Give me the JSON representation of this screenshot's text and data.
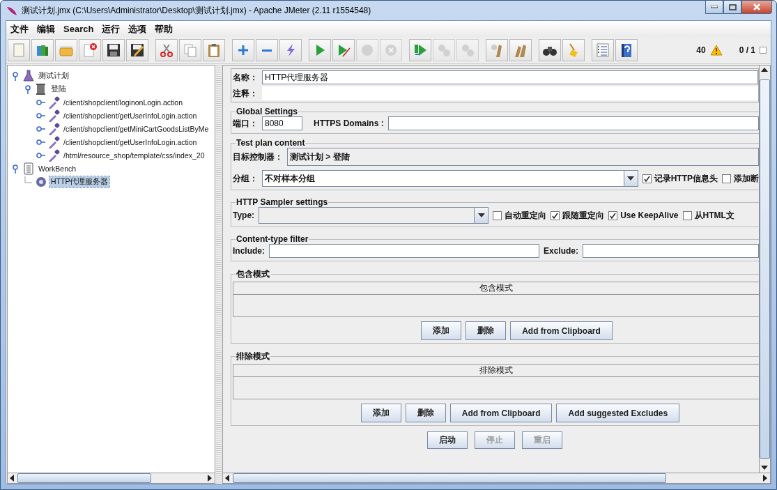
{
  "window": {
    "title": "测试计划.jmx (C:\\Users\\Administrator\\Desktop\\测试计划.jmx) - Apache JMeter (2.11 r1554548)"
  },
  "menu": [
    "文件",
    "编辑",
    "Search",
    "运行",
    "选项",
    "帮助"
  ],
  "toolbar": {
    "groups": [
      [
        {
          "kind": "new",
          "disabled": false
        },
        {
          "kind": "templates",
          "disabled": false
        },
        {
          "kind": "open",
          "disabled": false
        },
        {
          "kind": "close",
          "disabled": false
        },
        {
          "kind": "save",
          "disabled": false
        },
        {
          "kind": "saveas",
          "disabled": false
        }
      ],
      [
        {
          "kind": "cut",
          "disabled": false
        },
        {
          "kind": "copy",
          "disabled": false
        },
        {
          "kind": "paste",
          "disabled": false
        }
      ],
      [
        {
          "kind": "expand",
          "disabled": false
        },
        {
          "kind": "collapse",
          "disabled": false
        },
        {
          "kind": "toggle",
          "disabled": false
        }
      ],
      [
        {
          "kind": "start",
          "disabled": false
        },
        {
          "kind": "startnp",
          "disabled": false
        },
        {
          "kind": "stop",
          "disabled": true
        },
        {
          "kind": "shutdown",
          "disabled": true
        }
      ],
      [
        {
          "kind": "remotestart",
          "disabled": false
        },
        {
          "kind": "remotestop",
          "disabled": true
        },
        {
          "kind": "remoteshutdown",
          "disabled": true
        }
      ],
      [
        {
          "kind": "clear",
          "disabled": false
        },
        {
          "kind": "clearall",
          "disabled": false
        }
      ],
      [
        {
          "kind": "search",
          "disabled": false
        },
        {
          "kind": "reset",
          "disabled": false
        }
      ],
      [
        {
          "kind": "function",
          "disabled": false
        },
        {
          "kind": "help",
          "disabled": false
        }
      ]
    ],
    "error_count": "40",
    "threads": "0 / 1"
  },
  "tree": [
    {
      "label": "测试计划",
      "kind": "plan",
      "expanded": true,
      "selected": false,
      "children": [
        {
          "label": "登陆",
          "kind": "controller",
          "expanded": true,
          "selected": false,
          "children": [
            {
              "label": "/client/shopclient/loginonLogin.action",
              "kind": "sampler",
              "expanded": false,
              "selected": false
            },
            {
              "label": "/client/shopclient/getUserInfoLogin.action",
              "kind": "sampler",
              "expanded": false,
              "selected": false
            },
            {
              "label": "/client/shopclient/getMiniCartGoodsListByMe",
              "kind": "sampler",
              "expanded": false,
              "selected": false
            },
            {
              "label": "/client/shopclient/getUserInfoLogin.action",
              "kind": "sampler",
              "expanded": false,
              "selected": false
            },
            {
              "label": "/html/resource_shop/template/css/index_20",
              "kind": "sampler",
              "expanded": false,
              "selected": false
            }
          ]
        }
      ]
    },
    {
      "label": "WorkBench",
      "kind": "workbench",
      "expanded": true,
      "selected": false,
      "children": [
        {
          "label": "HTTP代理服务器",
          "kind": "proxy",
          "selected": true
        }
      ]
    }
  ],
  "form": {
    "name": {
      "label": "名称：",
      "value": "HTTP代理服务器"
    },
    "comment": {
      "label": "注释："
    },
    "global_settings": {
      "title": "Global Settings",
      "port": {
        "label": "端口：",
        "value": "8080"
      },
      "https_domains": {
        "label": "HTTPS Domains :"
      }
    },
    "test_plan_content": {
      "title": "Test plan content",
      "target": {
        "label": "目标控制器：",
        "value": "测试计划 > 登陆"
      },
      "grouping": {
        "label": "分组：",
        "value": "不对样本分组"
      },
      "checkboxes": [
        {
          "label": "记录HTTP信息头",
          "checked": true
        },
        {
          "label": "添加断",
          "checked": false
        }
      ]
    },
    "sampler_settings": {
      "title": "HTTP Sampler settings",
      "type": {
        "label": "Type:"
      },
      "checkboxes": [
        {
          "label": "自动重定向",
          "checked": false
        },
        {
          "label": "跟随重定向",
          "checked": true
        },
        {
          "label": "Use KeepAlive",
          "checked": true
        },
        {
          "label": "从HTML文",
          "checked": false
        }
      ]
    },
    "content_type_filter": {
      "title": "Content-type filter",
      "include": {
        "label": "Include:"
      },
      "exclude": {
        "label": "Exclude:"
      }
    },
    "patterns": [
      {
        "title": "包含模式",
        "column": "包含模式",
        "buttons": [
          "添加",
          "删除",
          "Add from Clipboard"
        ]
      },
      {
        "title": "排除模式",
        "column": "排除模式",
        "buttons": [
          "添加",
          "删除",
          "Add from Clipboard",
          "Add suggested Excludes"
        ]
      }
    ],
    "actions": [
      {
        "label": "启动",
        "disabled": false
      },
      {
        "label": "停止",
        "disabled": true
      },
      {
        "label": "重启",
        "disabled": true
      }
    ]
  }
}
